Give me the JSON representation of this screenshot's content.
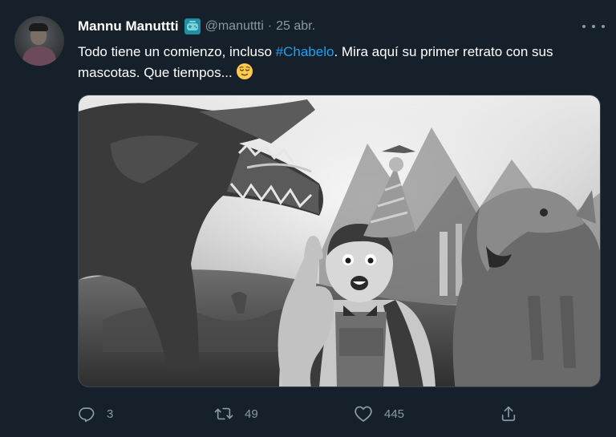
{
  "tweet": {
    "author_name": "Mannu Manuttti",
    "author_badge_icon": "game-controller-icon",
    "handle": "@manuttti",
    "separator": "·",
    "date": "25 abr.",
    "text_before": "Todo tiene un comienzo, incluso ",
    "hashtag": "#Chabelo",
    "text_after": ". Mira aquí su primer retrato con sus mascotas. Que tiempos...",
    "emoji": "relieved-face-emoji",
    "image_alt": "Photo of Chabelo with party hat next to dinosaurs"
  },
  "actions": {
    "replies": "3",
    "retweets": "49",
    "likes": "445"
  },
  "colors": {
    "background": "#15202b",
    "link": "#1da1f2",
    "secondary_text": "#8899a6",
    "border": "#38444d"
  }
}
